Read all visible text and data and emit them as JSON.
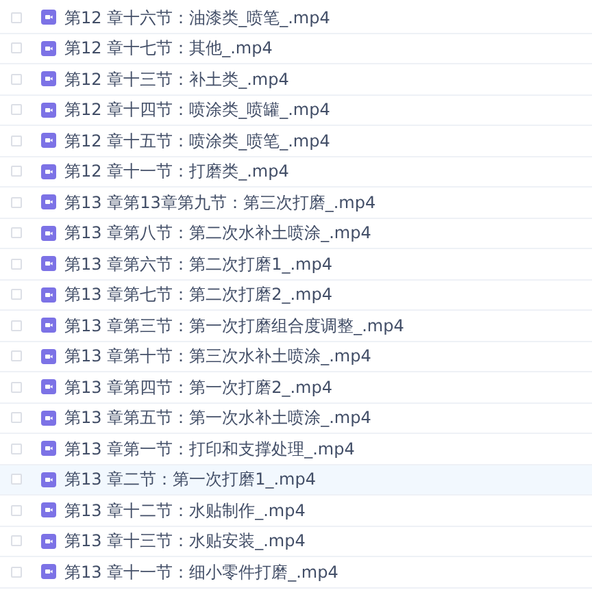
{
  "files": [
    {
      "name": "第12 章十六节：油漆类_喷笔_.mp4",
      "highlighted": false
    },
    {
      "name": "第12 章十七节：其他_.mp4",
      "highlighted": false
    },
    {
      "name": "第12 章十三节：补土类_.mp4",
      "highlighted": false
    },
    {
      "name": "第12 章十四节：喷涂类_喷罐_.mp4",
      "highlighted": false
    },
    {
      "name": "第12 章十五节：喷涂类_喷笔_.mp4",
      "highlighted": false
    },
    {
      "name": "第12 章十一节：打磨类_.mp4",
      "highlighted": false
    },
    {
      "name": "第13 章第13章第九节：第三次打磨_.mp4",
      "highlighted": false
    },
    {
      "name": "第13 章第八节：第二次水补土喷涂_.mp4",
      "highlighted": false
    },
    {
      "name": "第13 章第六节：第二次打磨1_.mp4",
      "highlighted": false
    },
    {
      "name": "第13 章第七节：第二次打磨2_.mp4",
      "highlighted": false
    },
    {
      "name": "第13 章第三节：第一次打磨组合度调整_.mp4",
      "highlighted": false
    },
    {
      "name": "第13 章第十节：第三次水补土喷涂_.mp4",
      "highlighted": false
    },
    {
      "name": "第13 章第四节：第一次打磨2_.mp4",
      "highlighted": false
    },
    {
      "name": "第13 章第五节：第一次水补土喷涂_.mp4",
      "highlighted": false
    },
    {
      "name": "第13 章第一节：打印和支撑处理_.mp4",
      "highlighted": false
    },
    {
      "name": "第13 章二节：第一次打磨1_.mp4",
      "highlighted": true
    },
    {
      "name": "第13 章十二节：水贴制作_.mp4",
      "highlighted": false
    },
    {
      "name": "第13 章十三节：水贴安装_.mp4",
      "highlighted": false
    },
    {
      "name": "第13 章十一节：细小零件打磨_.mp4",
      "highlighted": false
    }
  ]
}
